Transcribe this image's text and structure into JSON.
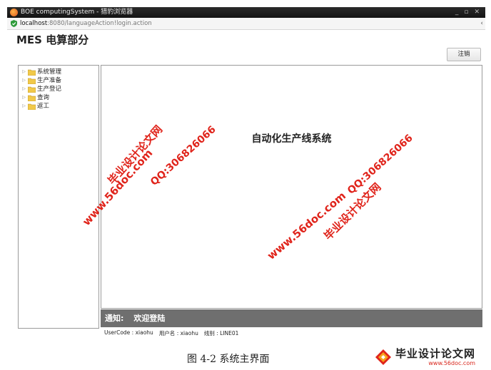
{
  "browser": {
    "window_title": "BOE computingSystem - 猎豹浏览器",
    "url_host": "localhost",
    "url_rest": ":8080/languageAction!login.action",
    "controls": [
      "_",
      "▫",
      "✕"
    ],
    "edge_char": "‹"
  },
  "app": {
    "title": "MES  电算部分",
    "logout_label": "注销"
  },
  "tree": {
    "items": [
      {
        "label": "系统管理"
      },
      {
        "label": "生产准备"
      },
      {
        "label": "生产登记"
      },
      {
        "label": "查询"
      },
      {
        "label": "返工"
      }
    ]
  },
  "main": {
    "system_title": "自动化生产线系统"
  },
  "notice": {
    "label": "通知:",
    "text": "欢迎登陆"
  },
  "status": {
    "usercode": "UserCode : xiaohu",
    "username": "用户名 : xiaohu",
    "line": "线别 : LINE01"
  },
  "watermarks": {
    "site_cn": "毕业设计论文网",
    "site_url": "www.56doc.com",
    "qq": "QQ:306826066"
  },
  "caption": "图 4-2  系统主界面",
  "footer_logo": {
    "name": "毕业设计论文网",
    "url": "www.56doc.com"
  },
  "colors": {
    "watermark": "#e0241b",
    "notice_bg": "#6f6f6f",
    "folder": "#f1c94a"
  }
}
